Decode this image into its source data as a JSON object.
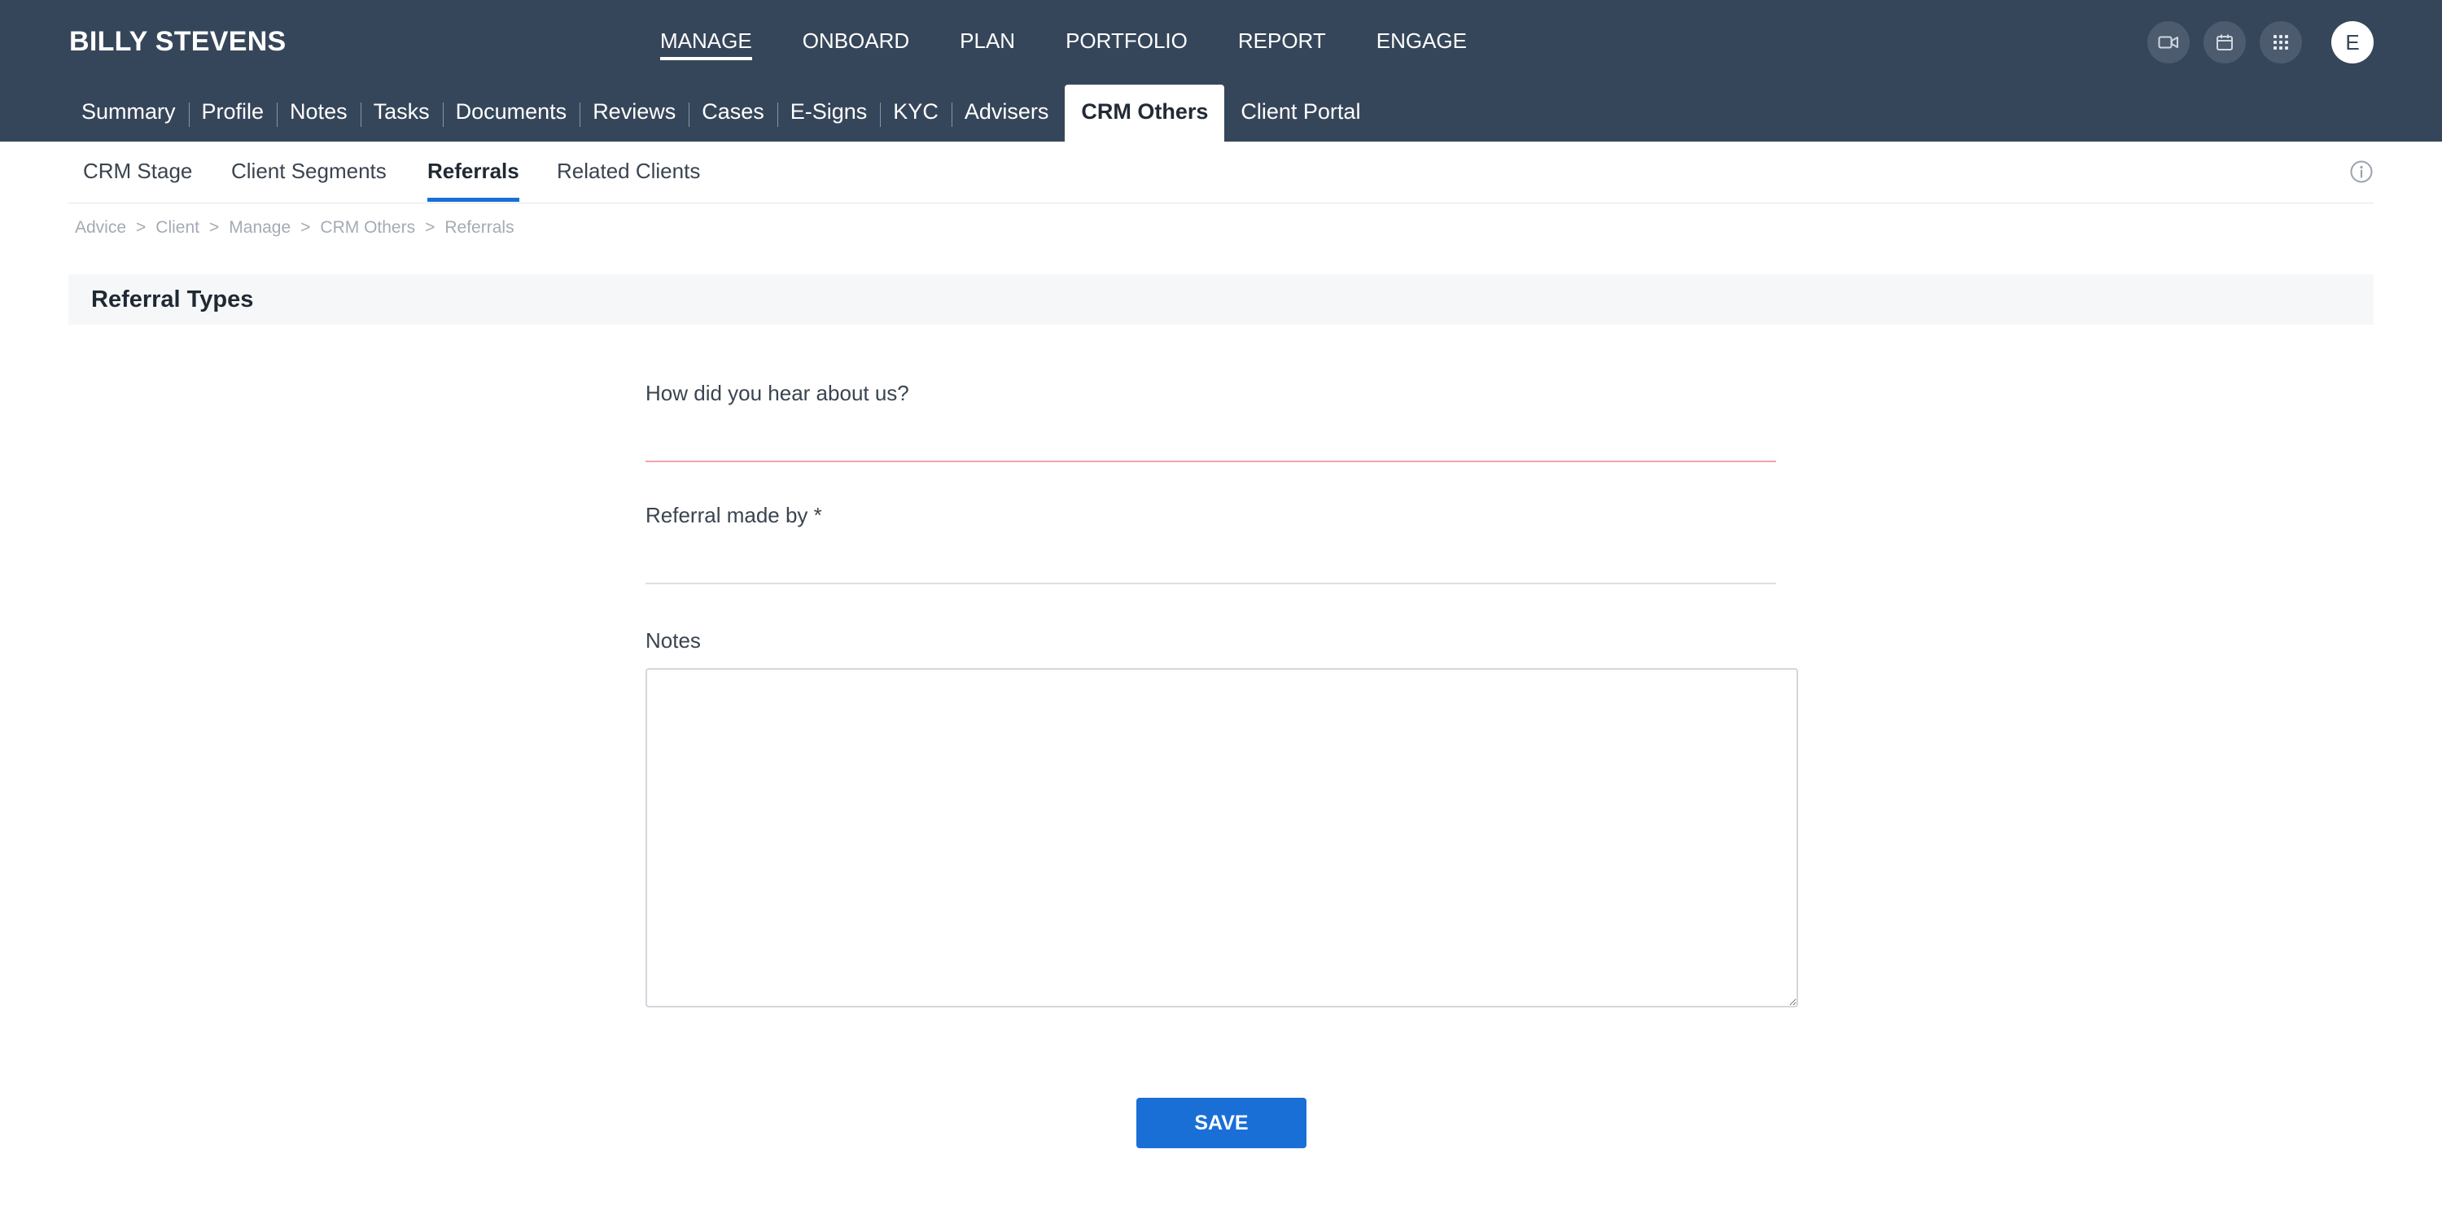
{
  "header": {
    "client_name": "BILLY STEVENS",
    "main_nav": [
      "MANAGE",
      "ONBOARD",
      "PLAN",
      "PORTFOLIO",
      "REPORT",
      "ENGAGE"
    ],
    "active_main": "MANAGE",
    "icons": [
      "video-icon",
      "calendar-icon",
      "apps-grid-icon"
    ],
    "avatar_initial": "E"
  },
  "sub_nav": {
    "tabs": [
      "Summary",
      "Profile",
      "Notes",
      "Tasks",
      "Documents",
      "Reviews",
      "Cases",
      "E-Signs",
      "KYC",
      "Advisers",
      "CRM Others",
      "Client Portal"
    ],
    "active": "CRM Others"
  },
  "crm_tabs": {
    "tabs": [
      "CRM Stage",
      "Client Segments",
      "Referrals",
      "Related Clients"
    ],
    "active": "Referrals"
  },
  "breadcrumb": [
    "Advice",
    "Client",
    "Manage",
    "CRM Others",
    "Referrals"
  ],
  "breadcrumb_separator": ">",
  "section": {
    "title": "Referral Types"
  },
  "form": {
    "heard_label": "How did you hear about us?",
    "heard_value": "",
    "referral_label": "Referral made by *",
    "referral_value": "",
    "notes_label": "Notes",
    "notes_value": "",
    "save_label": "SAVE"
  },
  "colors": {
    "header_bg": "#36465a",
    "accent": "#1a6fd6",
    "error_line": "#f2a4a9"
  }
}
